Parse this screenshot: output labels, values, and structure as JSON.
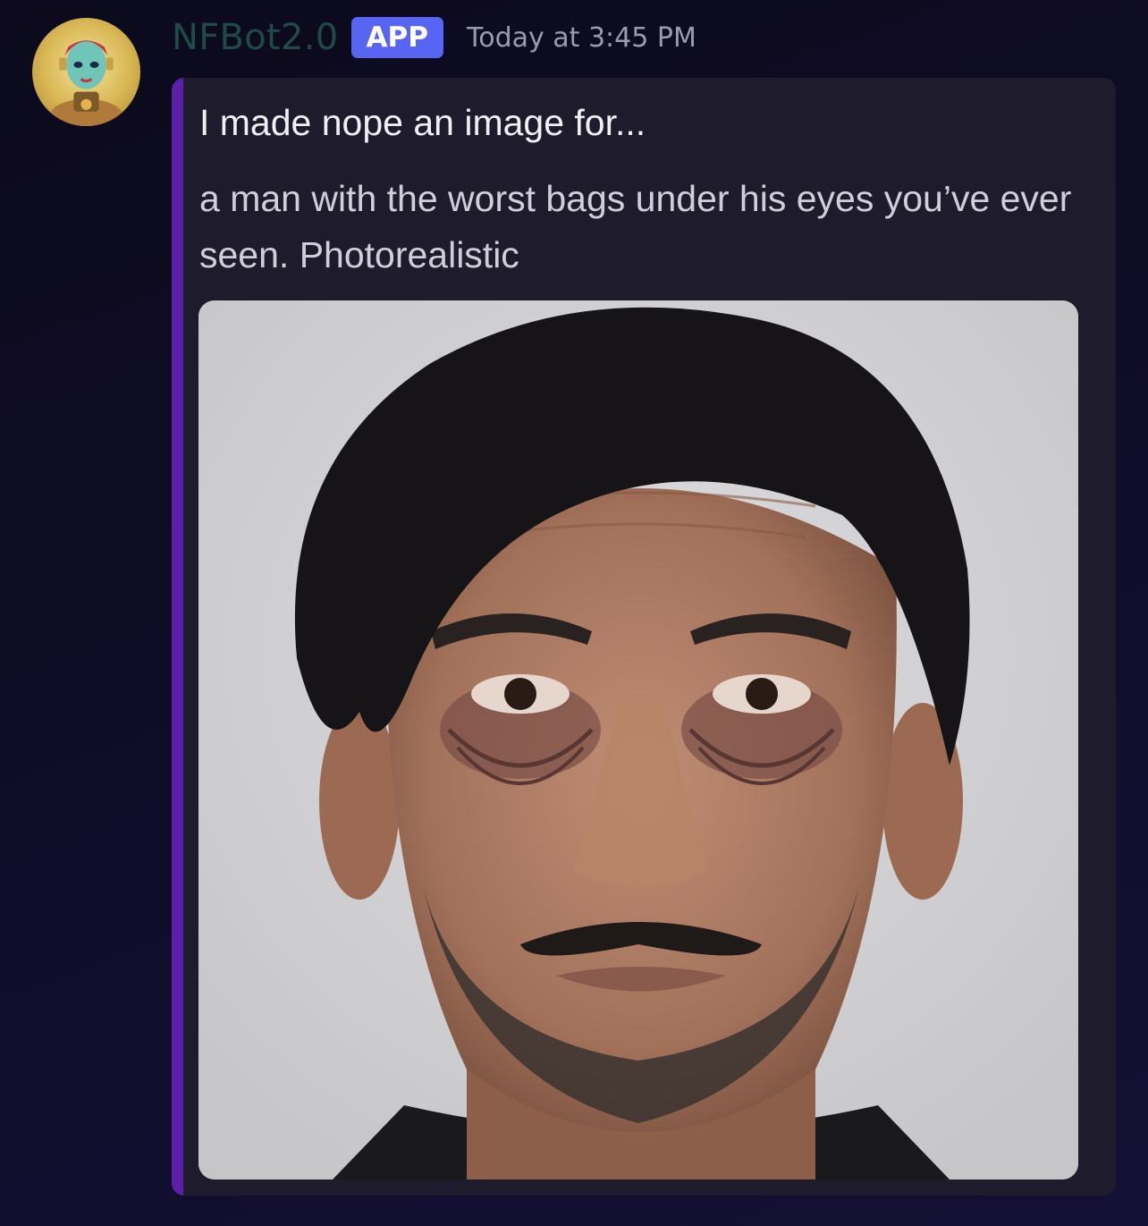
{
  "message": {
    "author": "NFBot2.0",
    "badge": "APP",
    "timestamp": "Today at 3:45 PM",
    "embed": {
      "title": "I made nope an image for...",
      "description": "a man with the worst bags under his eyes you’ve ever seen. Photorealistic",
      "accent_color": "#5c20a8",
      "image_subject": "photorealistic portrait of a tired man with deep under-eye bags"
    }
  },
  "colors": {
    "background": "#0e0c22",
    "embed_background": "#1e1c2c",
    "badge": "#5865f2",
    "username": "#1f4a45",
    "timestamp": "#9a9ab0"
  }
}
